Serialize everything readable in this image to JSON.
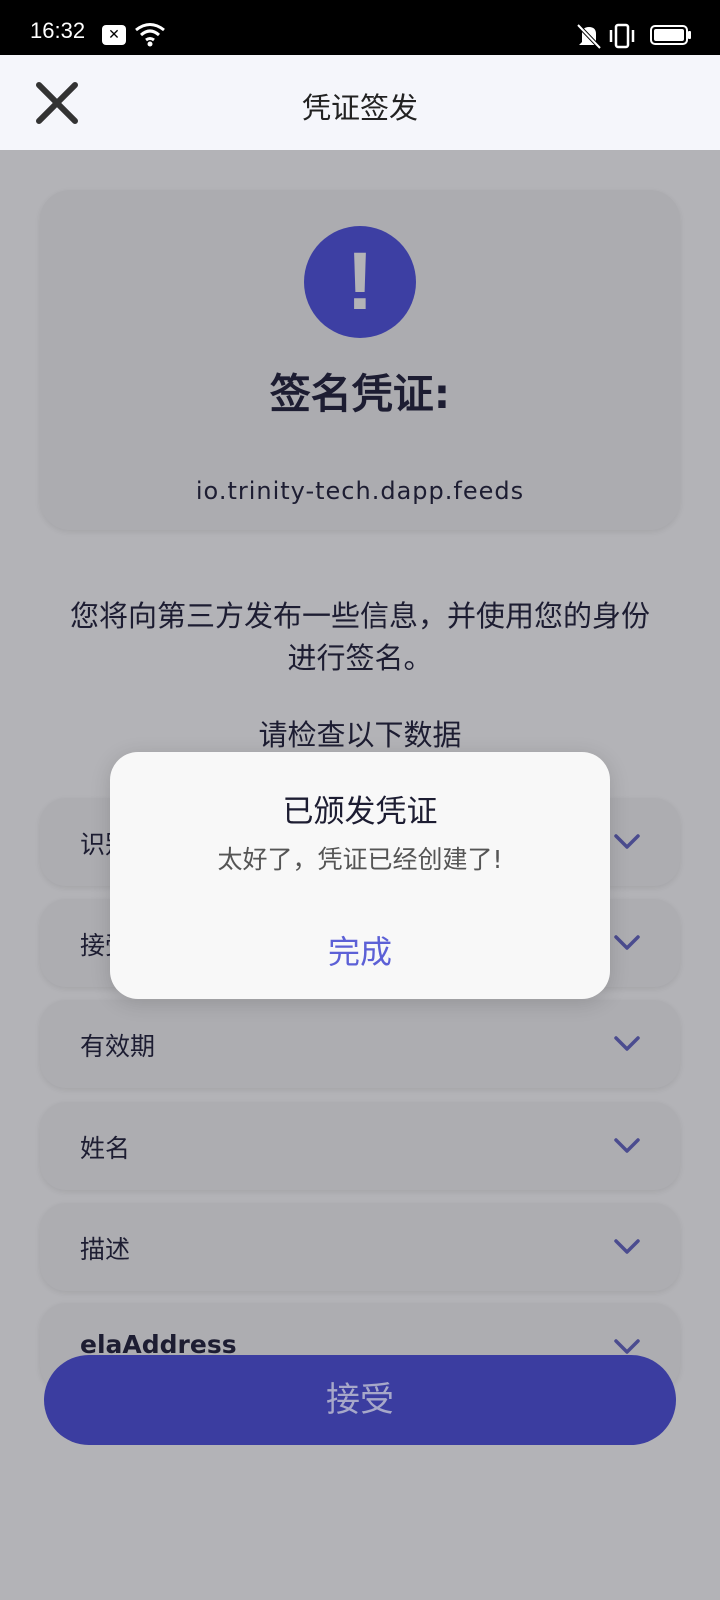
{
  "status_bar": {
    "time": "16:32",
    "notif_glyph": "✕",
    "icons": [
      "close-box-icon",
      "wifi-icon",
      "mute-icon",
      "vibrate-icon",
      "battery-icon"
    ]
  },
  "header": {
    "title": "凭证签发",
    "close_icon": "close-icon"
  },
  "card": {
    "alert_glyph": "!",
    "title": "签名凭证:",
    "app_id": "io.trinity-tech.dapp.feeds"
  },
  "description": "您将向第三方发布一些信息，并使用您的身份进行签名。",
  "check_label": "请检查以下数据",
  "rows": [
    {
      "label": "识别"
    },
    {
      "label": "接受"
    },
    {
      "label": "有效期"
    },
    {
      "label": "姓名"
    },
    {
      "label": "描述"
    },
    {
      "label": "elaAddress"
    }
  ],
  "accept_button": {
    "label": "接受"
  },
  "dialog": {
    "title": "已颁发凭证",
    "message": "太好了，凭证已经创建了!",
    "button_label": "完成"
  },
  "colors": {
    "accent": "#3d3fa3",
    "dialog_button": "#5c60d6",
    "backdrop": "#b3b3b7"
  }
}
